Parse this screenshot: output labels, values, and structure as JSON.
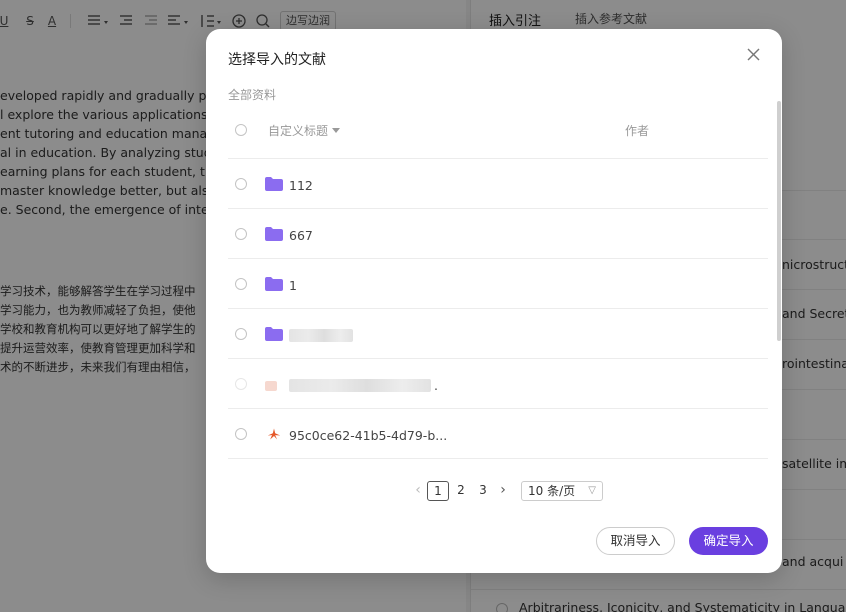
{
  "editor": {
    "toolbar": {
      "underline": "U",
      "strike": "S",
      "font_color": "A",
      "page_margin_button": "边写边润"
    },
    "english_lines": [
      "eveloped rapidly and gradually per",
      "l explore the various applications o",
      "ent tutoring and education manage",
      "al in education. By analyzing studer",
      "earning plans for each student, thu",
      "master knowledge better, but also s",
      "e. Second, the emergence of intellig"
    ],
    "chinese_lines": [
      "学习技术，能够解答学生在学习过程中",
      "学习能力，也为教师减轻了负担，使他",
      "学校和教育机构可以更好地了解学生的",
      "提升运营效率，使教育管理更加科学和",
      "术的不断进步，未来我们有理由相信，"
    ]
  },
  "panel": {
    "tabs": [
      "插入引注",
      "插入参考文献"
    ],
    "fragments": [
      "nicrostructu",
      "and Secreti",
      "rointestina",
      "satellite ima",
      "and acqui"
    ],
    "last_item": "Arbitrariness, Iconicity, and Systematicity in Language"
  },
  "modal": {
    "title": "选择导入的文献",
    "breadcrumb": "全部资料",
    "columns": {
      "title": "自定义标题",
      "author": "作者"
    },
    "rows": [
      {
        "type": "folder",
        "name": "112"
      },
      {
        "type": "folder",
        "name": "667"
      },
      {
        "type": "folder",
        "name": "1"
      },
      {
        "type": "folder",
        "name": ""
      },
      {
        "type": "file",
        "name": "."
      },
      {
        "type": "pdf",
        "name": "95c0ce62-41b5-4d79-b..."
      }
    ],
    "pagination": {
      "pages": [
        "1",
        "2",
        "3"
      ],
      "current": "1",
      "page_size": "10 条/页"
    },
    "cancel_label": "取消导入",
    "confirm_label": "确定导入"
  },
  "colors": {
    "accent": "#6a3fe0",
    "folder": "#8b6cf0",
    "pdf": "#e5582a"
  }
}
